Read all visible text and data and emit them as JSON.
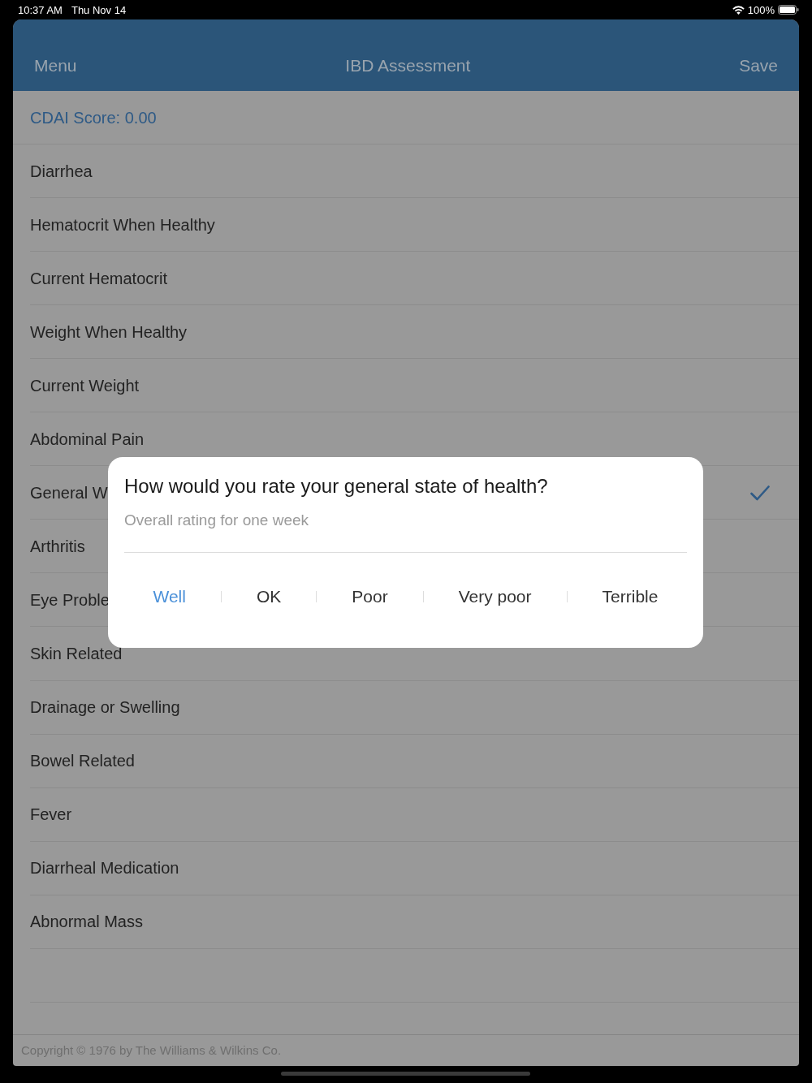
{
  "status_bar": {
    "time": "10:37 AM",
    "date": "Thu Nov 14",
    "battery": "100%"
  },
  "nav_bar": {
    "left": "Menu",
    "title": "IBD Assessment",
    "right": "Save"
  },
  "score": "CDAI Score: 0.00",
  "items": [
    {
      "label": "Diarrhea",
      "checked": false
    },
    {
      "label": "Hematocrit When Healthy",
      "checked": false
    },
    {
      "label": "Current Hematocrit",
      "checked": false
    },
    {
      "label": "Weight When Healthy",
      "checked": false
    },
    {
      "label": "Current Weight",
      "checked": false
    },
    {
      "label": "Abdominal Pain",
      "checked": false
    },
    {
      "label": "General W",
      "checked": true
    },
    {
      "label": "Arthritis",
      "checked": false
    },
    {
      "label": "Eye Proble",
      "checked": false
    },
    {
      "label": "Skin Related",
      "checked": false
    },
    {
      "label": "Drainage or Swelling",
      "checked": false
    },
    {
      "label": "Bowel Related",
      "checked": false
    },
    {
      "label": "Fever",
      "checked": false
    },
    {
      "label": "Diarrheal Medication",
      "checked": false
    },
    {
      "label": "Abnormal Mass",
      "checked": false
    }
  ],
  "footer": "Copyright © 1976 by The Williams & Wilkins Co.",
  "dialog": {
    "title": "How would you rate your general state of health?",
    "subtitle": "Overall rating for one week",
    "options": [
      {
        "label": "Well",
        "selected": true
      },
      {
        "label": "OK",
        "selected": false
      },
      {
        "label": "Poor",
        "selected": false
      },
      {
        "label": "Very poor",
        "selected": false
      },
      {
        "label": "Terrible",
        "selected": false
      }
    ]
  }
}
